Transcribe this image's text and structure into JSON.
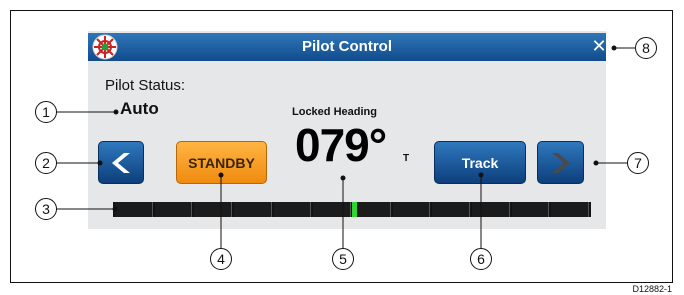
{
  "dialog": {
    "title": "Pilot Control",
    "title_icon": "helm-icon",
    "close_icon": "close-icon",
    "status_label": "Pilot Status:",
    "status_value": "Auto",
    "heading_label": "Locked Heading",
    "heading_value": "079°",
    "heading_unit": "T",
    "buttons": {
      "prev_icon": "chevron-left-icon",
      "standby_label": "STANDBY",
      "track_label": "Track",
      "next_icon": "chevron-right-icon"
    },
    "course_bar": {
      "segments": 12,
      "indicator": "center"
    }
  },
  "callouts": {
    "c1": "1",
    "c2": "2",
    "c3": "3",
    "c4": "4",
    "c5": "5",
    "c6": "6",
    "c7": "7",
    "c8": "8"
  },
  "figure_code": "D12882-1",
  "colors": {
    "titlebar": "#1f63a8",
    "dialog_bg": "#e6e7e8",
    "standby": "#f59a1f",
    "blue_button": "#1c5a9f",
    "indicator": "#2fd435"
  }
}
